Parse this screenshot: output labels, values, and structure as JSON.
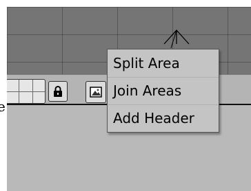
{
  "menu": {
    "items": [
      {
        "label": "Split Area"
      },
      {
        "label": "Join Areas"
      },
      {
        "label": "Add Header"
      }
    ]
  },
  "partial_text": "e",
  "icons": {
    "grid": "grid-layout-icon",
    "lock": "lock-icon",
    "image": "image-icon",
    "axis": "axis-gizmo-icon"
  },
  "colors": {
    "viewport": "#757575",
    "header": "#b4b4b4",
    "menu_bg": "#c4c4c4",
    "lower_area": "#b9b9b9"
  }
}
